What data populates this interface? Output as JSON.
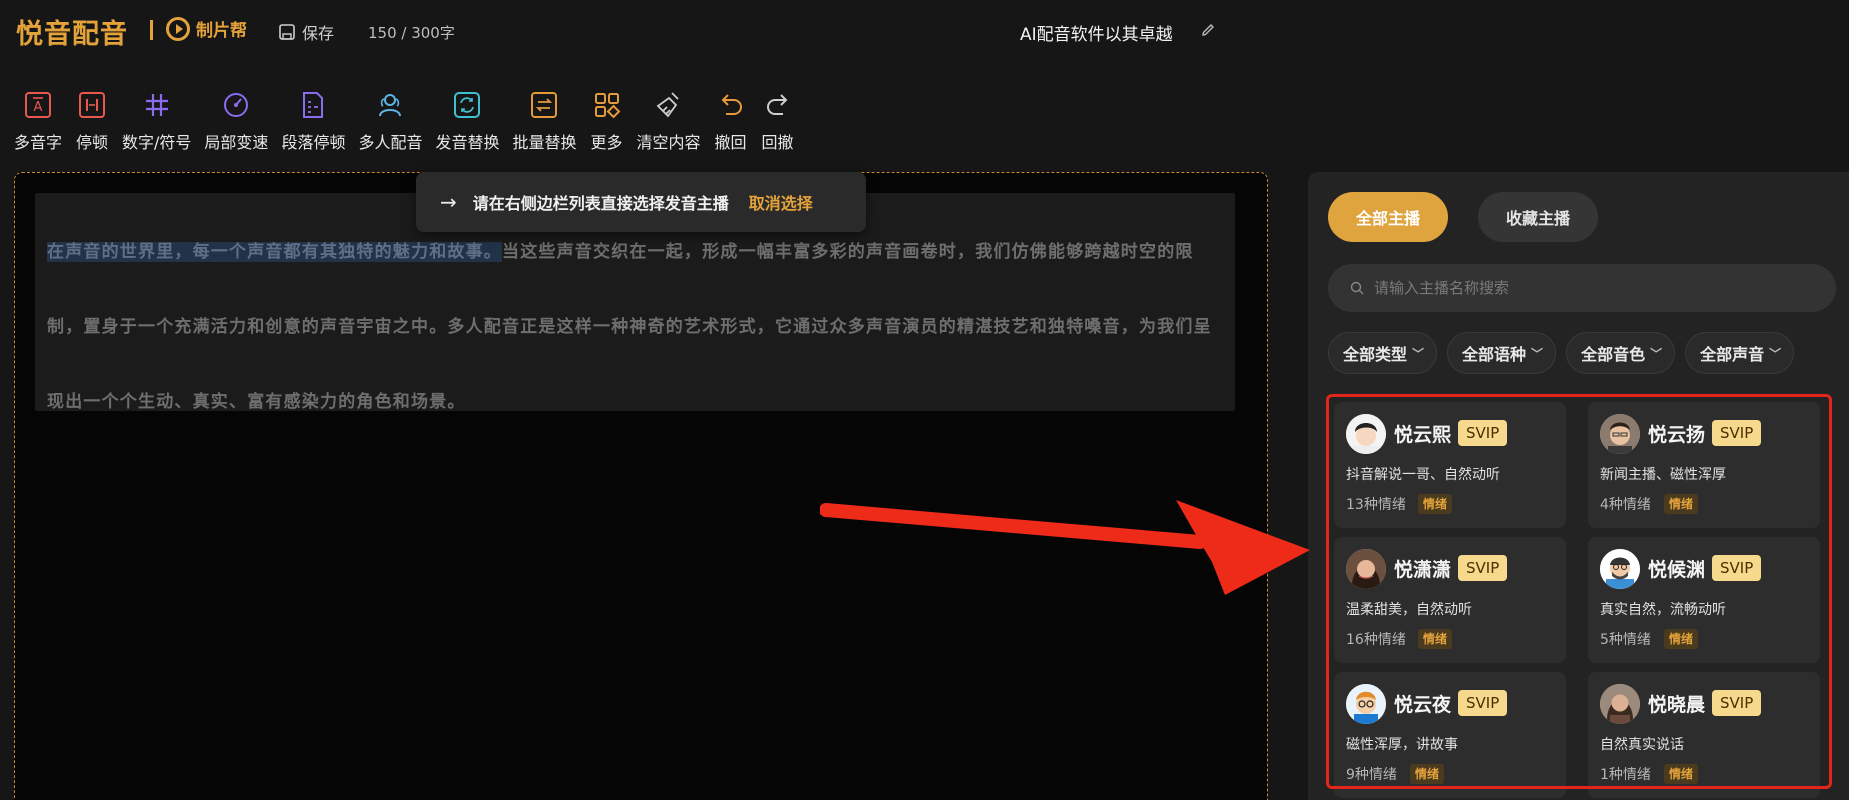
{
  "header": {
    "logo_text": "悦音配音",
    "logo2_text": "制片帮",
    "save_label": "保存",
    "word_count": "150 / 300字",
    "doc_title": "AI配音软件以其卓越"
  },
  "toolbar": [
    {
      "label": "多音字",
      "icon": "polyphone-icon"
    },
    {
      "label": "停顿",
      "icon": "pause-icon"
    },
    {
      "label": "数字/符号",
      "icon": "hash-icon"
    },
    {
      "label": "局部变速",
      "icon": "speed-dial-icon"
    },
    {
      "label": "段落停顿",
      "icon": "paragraph-pause-icon"
    },
    {
      "label": "多人配音",
      "icon": "multi-user-icon"
    },
    {
      "label": "发音替换",
      "icon": "replace-icon"
    },
    {
      "label": "批量替换",
      "icon": "batch-replace-icon"
    },
    {
      "label": "更多",
      "icon": "grid-more-icon"
    },
    {
      "label": "清空内容",
      "icon": "broom-icon"
    },
    {
      "label": "撤回",
      "icon": "undo-icon"
    },
    {
      "label": "回撤",
      "icon": "redo-icon"
    }
  ],
  "editor": {
    "highlighted_text": "在声音的世界里，每一个声音都有其独特的魅力和故事。",
    "rest_text": "当这些声音交织在一起，形成一幅丰富多彩的声音画卷时，我们仿佛能够跨越时空的限制，置身于一个充满活力和创意的声音宇宙之中。多人配音正是这样一种神奇的艺术形式，它通过众多声音演员的精湛技艺和独特嗓音，为我们呈现出一个个生动、真实、富有感染力的角色和场景。"
  },
  "tooltip": {
    "arrow": "→",
    "message": "请在右侧边栏列表直接选择发音主播",
    "cancel": "取消选择"
  },
  "sidebar": {
    "tab_all": "全部主播",
    "tab_fav": "收藏主播",
    "search_placeholder": "请输入主播名称搜索",
    "filters": [
      "全部类型",
      "全部语种",
      "全部音色",
      "全部声音"
    ],
    "voices": [
      {
        "name": "悦云熙",
        "badge": "SVIP",
        "desc": "抖音解说一哥、自然动听",
        "emotions": "13种情绪",
        "tag": "情绪"
      },
      {
        "name": "悦云扬",
        "badge": "SVIP",
        "desc": "新闻主播、磁性浑厚",
        "emotions": "4种情绪",
        "tag": "情绪"
      },
      {
        "name": "悦潇潇",
        "badge": "SVIP",
        "desc": "温柔甜美，自然动听",
        "emotions": "16种情绪",
        "tag": "情绪"
      },
      {
        "name": "悦候渊",
        "badge": "SVIP",
        "desc": "真实自然，流畅动听",
        "emotions": "5种情绪",
        "tag": "情绪"
      },
      {
        "name": "悦云夜",
        "badge": "SVIP",
        "desc": "磁性浑厚，讲故事",
        "emotions": "9种情绪",
        "tag": "情绪"
      },
      {
        "name": "悦晓晨",
        "badge": "SVIP",
        "desc": "自然真实说话",
        "emotions": "1种情绪",
        "tag": "情绪"
      }
    ]
  },
  "colors": {
    "accent": "#e4a23a",
    "annotation_red": "#e3261b"
  }
}
